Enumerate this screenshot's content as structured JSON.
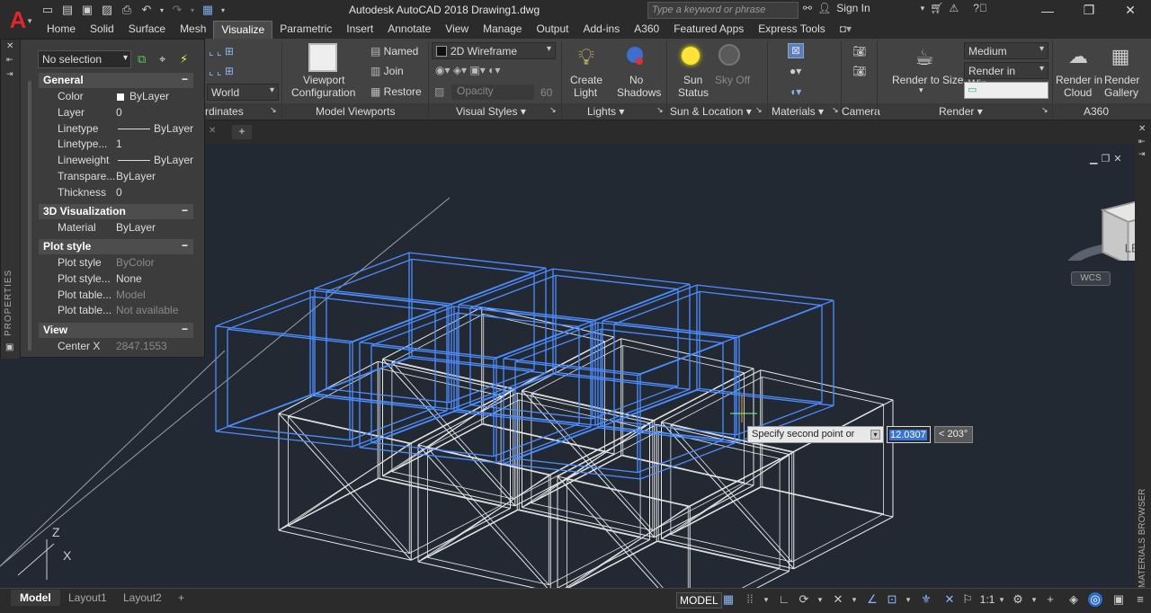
{
  "app": {
    "title": "Autodesk AutoCAD 2018   Drawing1.dwg",
    "logo": "A",
    "search_placeholder": "Type a keyword or phrase",
    "sign_in": "Sign In"
  },
  "ribbon_tabs": [
    "Home",
    "Solid",
    "Surface",
    "Mesh",
    "Visualize",
    "Parametric",
    "Insert",
    "Annotate",
    "View",
    "Manage",
    "Output",
    "Add-ins",
    "A360",
    "Featured Apps",
    "Express Tools"
  ],
  "active_tab": "Visualize",
  "ribbon": {
    "coords_world": "World",
    "coords_label": "rdinates",
    "viewport_config": [
      "Viewport",
      "Configuration"
    ],
    "named": "Named",
    "join": "Join",
    "restore": "Restore",
    "model_viewports": "Model Viewports",
    "visual_style": "2D Wireframe",
    "opacity_label": "Opacity",
    "opacity_value": "60",
    "visual_styles": "Visual Styles",
    "create_light": [
      "Create",
      "Light"
    ],
    "no_shadows": [
      "No",
      "Shadows"
    ],
    "lights": "Lights",
    "sun_status": [
      "Sun",
      "Status"
    ],
    "sky_off": [
      "Sky Off"
    ],
    "sun_location": "Sun & Location",
    "materials": "Materials",
    "camera": "Camera",
    "render_to_size": "Render to Size",
    "render_quality": "Medium",
    "render_in": "Render in Win...",
    "render": "Render",
    "render_in_cloud": [
      "Render in",
      "Cloud"
    ],
    "render_gallery": [
      "Render",
      "Gallery"
    ],
    "a360": "A360"
  },
  "properties": {
    "selection": "No selection",
    "strip_label": "PROPERTIES",
    "groups": {
      "general": "General",
      "viz3d": "3D Visualization",
      "plot": "Plot style",
      "view": "View"
    },
    "general_rows": [
      {
        "k": "Color",
        "v": "ByLayer"
      },
      {
        "k": "Layer",
        "v": "0"
      },
      {
        "k": "Linetype",
        "v": "ByLayer"
      },
      {
        "k": "Linetype...",
        "v": "1"
      },
      {
        "k": "Lineweight",
        "v": "ByLayer"
      },
      {
        "k": "Transpare...",
        "v": "ByLayer"
      },
      {
        "k": "Thickness",
        "v": "0"
      }
    ],
    "viz_rows": [
      {
        "k": "Material",
        "v": "ByLayer"
      }
    ],
    "plot_rows": [
      {
        "k": "Plot style",
        "v": "ByColor"
      },
      {
        "k": "Plot style...",
        "v": "None"
      },
      {
        "k": "Plot table...",
        "v": "Model"
      },
      {
        "k": "Plot table...",
        "v": "Not available"
      }
    ],
    "view_rows": [
      {
        "k": "Center X",
        "v": "2847.1553"
      }
    ]
  },
  "command_tip": {
    "prompt": "Specify second point or",
    "value": "12.0307",
    "angle": "< 203°"
  },
  "viewcube": {
    "face": "LEFT",
    "wcs": "WCS"
  },
  "side_panel": "MATERIALS BROWSER",
  "layout_tabs": [
    "Model",
    "Layout1",
    "Layout2"
  ],
  "status": {
    "model": "MODEL",
    "scale": "1:1"
  },
  "colors": {
    "selected_wire": "#4d8dff",
    "wire": "#e8e8e8",
    "background": "#222933"
  }
}
